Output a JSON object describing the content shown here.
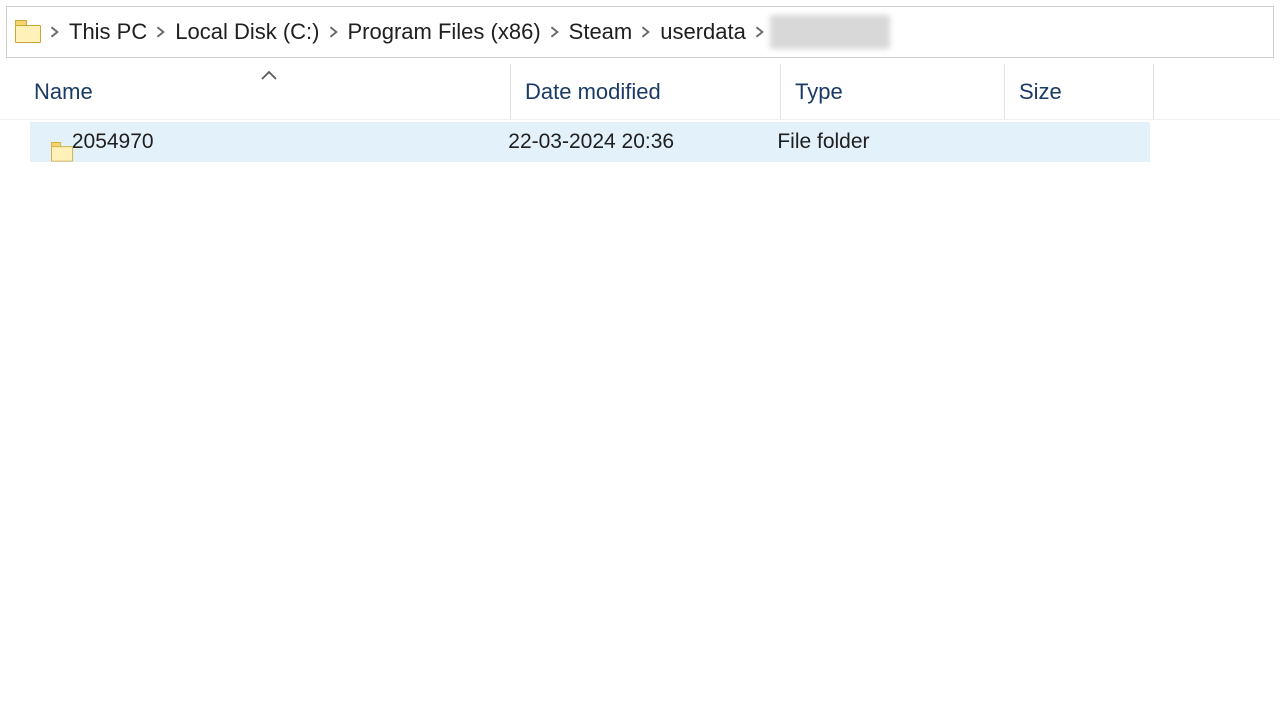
{
  "breadcrumb": {
    "items": [
      {
        "label": "This PC"
      },
      {
        "label": "Local Disk (C:)"
      },
      {
        "label": "Program Files (x86)"
      },
      {
        "label": "Steam"
      },
      {
        "label": "userdata"
      }
    ],
    "trailing_redacted": true
  },
  "columns": {
    "name": "Name",
    "date_modified": "Date modified",
    "type": "Type",
    "size": "Size",
    "sorted_column": "name",
    "sort_direction": "asc"
  },
  "rows": [
    {
      "name": "2054970",
      "date_modified": "22-03-2024 20:36",
      "type": "File folder",
      "size": ""
    }
  ],
  "icons": {
    "folder": "folder-icon",
    "chevron": "chevron-right-icon",
    "sort_asc": "sort-up-icon"
  }
}
